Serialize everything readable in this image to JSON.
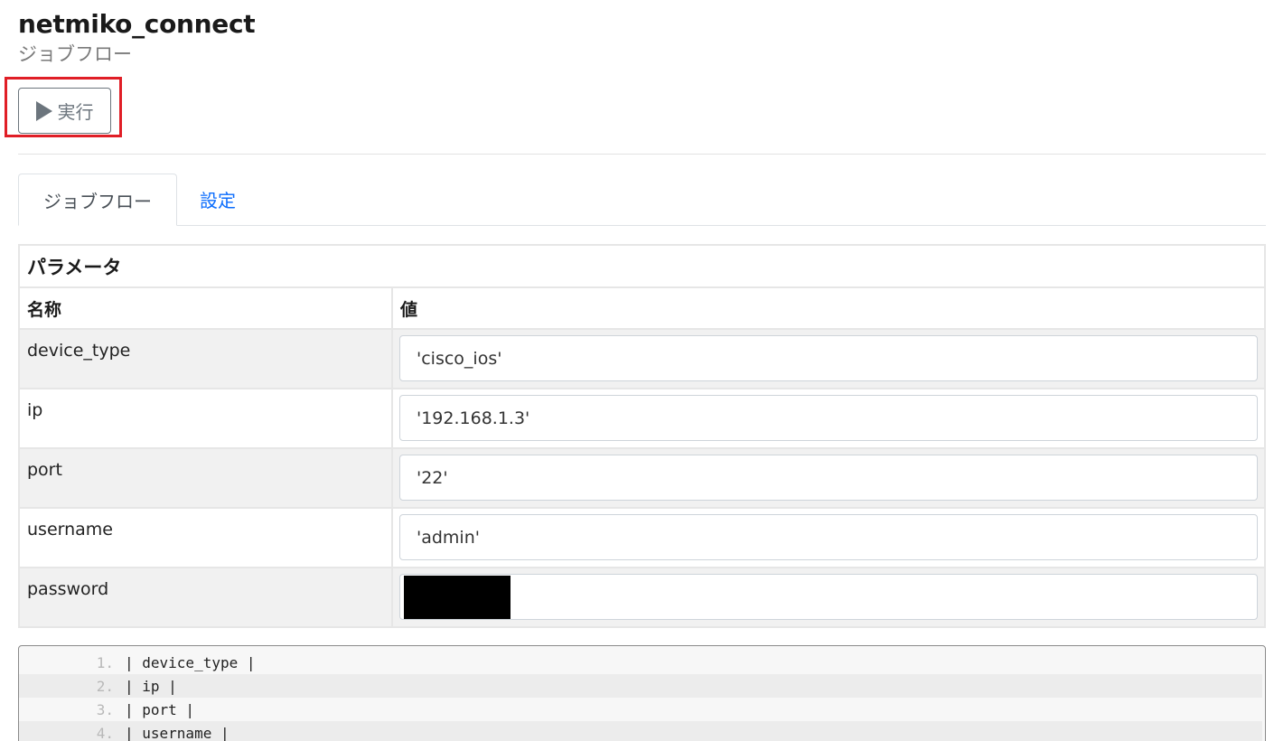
{
  "header": {
    "title": "netmiko_connect",
    "subtitle": "ジョブフロー"
  },
  "toolbar": {
    "run_label": "実行",
    "run_icon": "play-icon"
  },
  "tabs": [
    {
      "label": "ジョブフロー",
      "active": true
    },
    {
      "label": "設定",
      "active": false
    }
  ],
  "params": {
    "caption": "パラメータ",
    "columns": [
      "名称",
      "値"
    ],
    "rows": [
      {
        "name": "device_type",
        "value": "'cisco_ios'"
      },
      {
        "name": "ip",
        "value": "'192.168.1.3'"
      },
      {
        "name": "port",
        "value": "'22'"
      },
      {
        "name": "username",
        "value": "'admin'"
      },
      {
        "name": "password",
        "value": ""
      }
    ]
  },
  "code": {
    "lines": [
      {
        "num": "1.",
        "text": "| device_type |"
      },
      {
        "num": "2.",
        "text": "| ip |"
      },
      {
        "num": "3.",
        "text": "| port |"
      },
      {
        "num": "4.",
        "text": "| username |"
      }
    ]
  },
  "colors": {
    "highlight": "#e01e26",
    "link": "#0d6efd",
    "row_alt": "#f1f1f1"
  }
}
